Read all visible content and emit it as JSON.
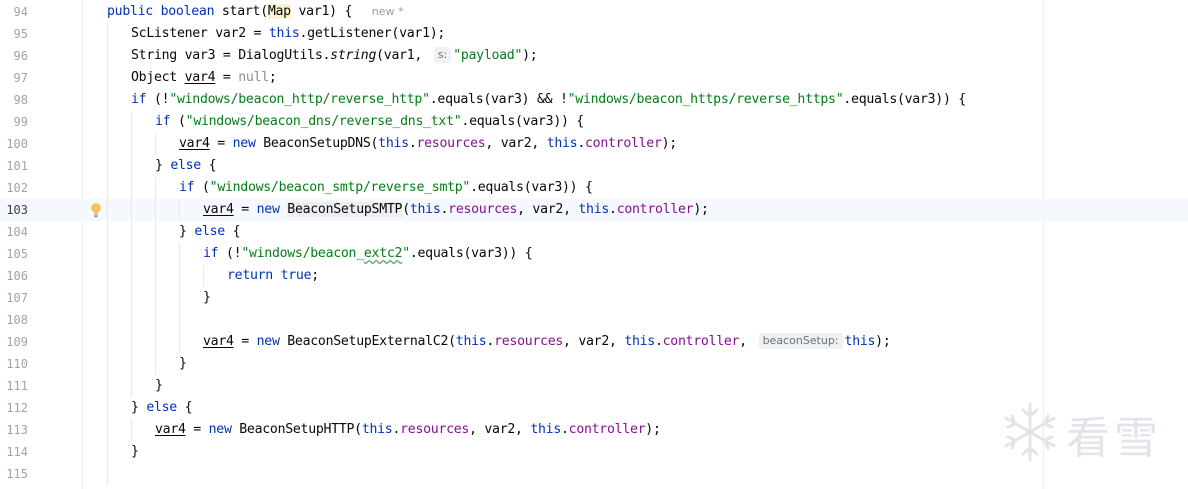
{
  "editor": {
    "current_line": 103,
    "author_hint": "new *",
    "lines": [
      {
        "n": "94"
      },
      {
        "n": "95"
      },
      {
        "n": "96"
      },
      {
        "n": "97"
      },
      {
        "n": "98"
      },
      {
        "n": "99"
      },
      {
        "n": "100"
      },
      {
        "n": "101"
      },
      {
        "n": "102"
      },
      {
        "n": "103"
      },
      {
        "n": "104"
      },
      {
        "n": "105"
      },
      {
        "n": "106"
      },
      {
        "n": "107"
      },
      {
        "n": "108"
      },
      {
        "n": "109"
      },
      {
        "n": "110"
      },
      {
        "n": "111"
      },
      {
        "n": "112"
      },
      {
        "n": "113"
      },
      {
        "n": "114"
      },
      {
        "n": "115"
      }
    ],
    "inlay_hints": {
      "s": "s:",
      "beaconSetup": "beaconSetup:"
    }
  },
  "watermark": {
    "text": "看雪"
  },
  "colors": {
    "keyword": "#0033b3",
    "string": "#067d17",
    "field": "#871094",
    "current_line_bg": "#f5f8fe",
    "bulb": "#f2c55c"
  },
  "icons": {
    "gutter_line_103": "lightbulb-icon",
    "watermark": "snowflake-icon"
  }
}
